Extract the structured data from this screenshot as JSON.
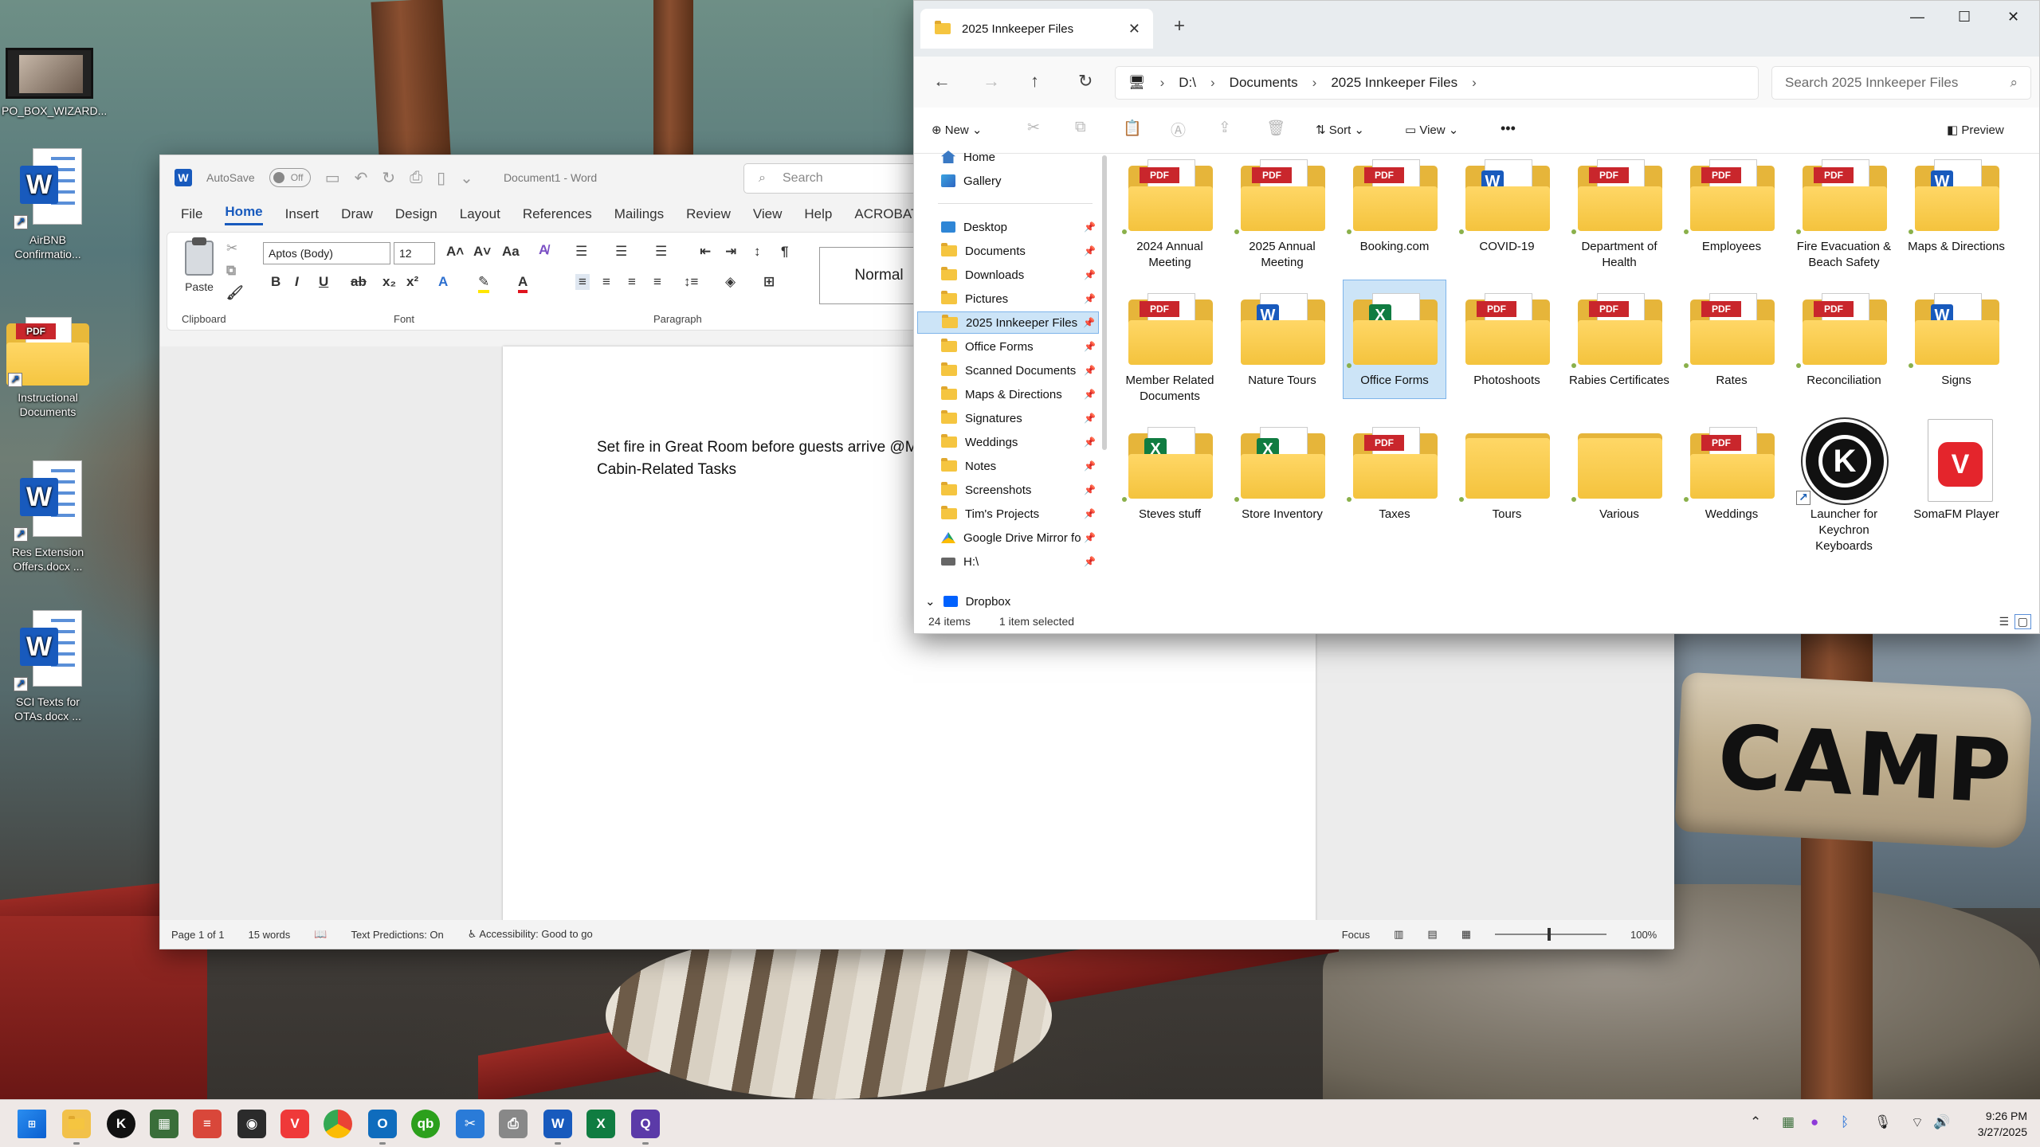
{
  "desktop": {
    "icons": [
      {
        "label": "PO_BOX_WIZARD..."
      },
      {
        "label": "AirBNB Confirmatio..."
      },
      {
        "label": "Instructional Documents"
      },
      {
        "label": "Res Extension Offers.docx ..."
      },
      {
        "label": "SCI Texts for OTAs.docx ..."
      }
    ],
    "sign_text": "CAMP"
  },
  "word": {
    "autosave_label": "AutoSave",
    "autosave_state": "Off",
    "doc_title": "Document1",
    "app_name": "Word",
    "search_placeholder": "Search",
    "tabs": [
      "File",
      "Home",
      "Insert",
      "Draw",
      "Design",
      "Layout",
      "References",
      "Mailings",
      "Review",
      "View",
      "Help",
      "ACROBAT"
    ],
    "paste_label": "Paste",
    "font_name": "Aptos (Body)",
    "font_size": "12",
    "group_clipboard": "Clipboard",
    "group_font": "Font",
    "group_paragraph": "Paragraph",
    "style_normal": "Normal",
    "doc_lines": [
      "Set fire in Great Room before guests arrive @M",
      "Cabin-Related Tasks"
    ],
    "status": {
      "page": "Page 1 of 1",
      "words": "15 words",
      "predictions": "Text Predictions: On",
      "accessibility": "Accessibility: Good to go",
      "focus": "Focus",
      "zoom": "100%"
    }
  },
  "explorer": {
    "tab_title": "2025 Innkeeper Files",
    "breadcrumb": [
      "D:\\",
      "Documents",
      "2025 Innkeeper Files"
    ],
    "search_placeholder": "Search 2025 Innkeeper Files",
    "cmd": {
      "new": "New",
      "sort": "Sort",
      "view": "View",
      "more": "•••",
      "preview": "Preview"
    },
    "nav": [
      {
        "label": "Home",
        "icon": "home-icon"
      },
      {
        "label": "Gallery",
        "icon": "gallery-icon"
      },
      {
        "label": "Desktop",
        "icon": "desktop-icon"
      },
      {
        "label": "Documents",
        "icon": "folder-icon"
      },
      {
        "label": "Downloads",
        "icon": "folder-icon"
      },
      {
        "label": "Pictures",
        "icon": "folder-icon"
      },
      {
        "label": "2025 Innkeeper Files",
        "icon": "folder-icon"
      },
      {
        "label": "Office Forms",
        "icon": "folder-icon"
      },
      {
        "label": "Scanned Documents",
        "icon": "folder-icon"
      },
      {
        "label": "Maps & Directions",
        "icon": "folder-icon"
      },
      {
        "label": "Signatures",
        "icon": "folder-icon"
      },
      {
        "label": "Weddings",
        "icon": "folder-icon"
      },
      {
        "label": "Notes",
        "icon": "folder-icon"
      },
      {
        "label": "Screenshots",
        "icon": "folder-icon"
      },
      {
        "label": "Tim's Projects",
        "icon": "folder-icon"
      },
      {
        "label": "Google Drive Mirror fo",
        "icon": "google-drive-icon"
      },
      {
        "label": "H:\\",
        "icon": "drive-icon"
      },
      {
        "label": "Dropbox",
        "icon": "dropbox-icon"
      }
    ],
    "items": [
      {
        "label": "2024 Annual Meeting",
        "kind": "pdf"
      },
      {
        "label": "2025 Annual Meeting",
        "kind": "pdf"
      },
      {
        "label": "Booking.com",
        "kind": "pdf"
      },
      {
        "label": "COVID-19",
        "kind": "word"
      },
      {
        "label": "Department of Health",
        "kind": "pdf"
      },
      {
        "label": "Employees",
        "kind": "pdf"
      },
      {
        "label": "Fire Evacuation & Beach Safety",
        "kind": "pdf"
      },
      {
        "label": "Maps & Directions",
        "kind": "word"
      },
      {
        "label": "Member Related Documents",
        "kind": "pdf"
      },
      {
        "label": "Nature Tours",
        "kind": "word"
      },
      {
        "label": "Office Forms",
        "kind": "excel"
      },
      {
        "label": "Photoshoots",
        "kind": "pdf"
      },
      {
        "label": "Rabies Certificates",
        "kind": "pdf"
      },
      {
        "label": "Rates",
        "kind": "pdf"
      },
      {
        "label": "Reconciliation",
        "kind": "pdf"
      },
      {
        "label": "Signs",
        "kind": "word"
      },
      {
        "label": "Steves stuff",
        "kind": "excel"
      },
      {
        "label": "Store Inventory",
        "kind": "excel"
      },
      {
        "label": "Taxes",
        "kind": "pdf"
      },
      {
        "label": "Tours",
        "kind": "plain"
      },
      {
        "label": "Various",
        "kind": "plain"
      },
      {
        "label": "Weddings",
        "kind": "pdf"
      },
      {
        "label": "Launcher for Keychron Keyboards",
        "kind": "keychron"
      },
      {
        "label": "SomaFM Player",
        "kind": "vivaldi"
      }
    ],
    "status_count": "24 items",
    "status_selected": "1 item selected"
  },
  "taskbar": {
    "time": "9:26 PM",
    "date": "3/27/2025"
  }
}
